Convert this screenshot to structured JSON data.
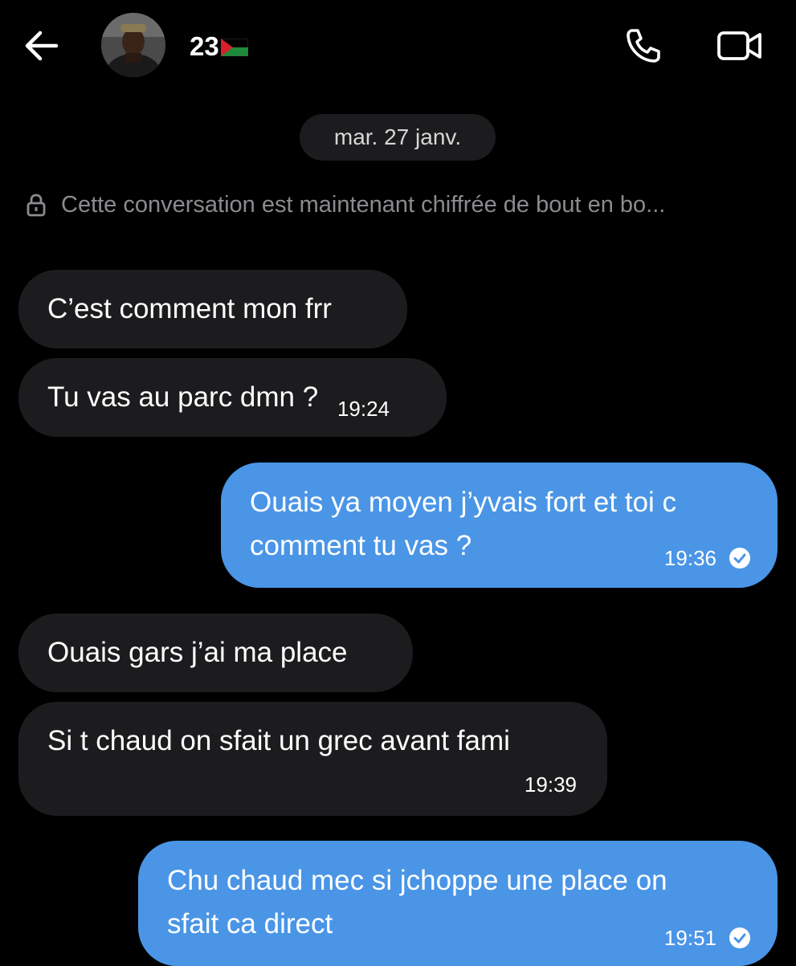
{
  "header": {
    "contact_name": "23",
    "back_icon": "arrow-left-icon",
    "call_icon": "phone-icon",
    "video_icon": "video-camera-icon"
  },
  "date_separator": "mar. 27 janv.",
  "encryption_notice": "Cette conversation est maintenant chiffrée de bout en bo...",
  "messages": [
    {
      "direction": "incoming",
      "text": "C’est comment mon frr",
      "time": ""
    },
    {
      "direction": "incoming",
      "text": "Tu vas au parc dmn ?",
      "time": "19:24"
    },
    {
      "direction": "outgoing",
      "text_line1": "Ouais ya moyen j’yvais fort et toi c",
      "text_line2": "comment tu vas ?",
      "time": "19:36",
      "status": "read"
    },
    {
      "direction": "incoming",
      "text": "Ouais gars j’ai ma place",
      "time": ""
    },
    {
      "direction": "incoming",
      "text": "Si t chaud on sfait un grec avant fami",
      "time": "19:39"
    },
    {
      "direction": "outgoing",
      "text_line1": "Chu chaud mec si jchoppe une place on",
      "text_line2": "sfait ca direct",
      "time": "19:51",
      "status": "read"
    }
  ],
  "colors": {
    "background": "#000000",
    "incoming_bubble": "#1c1c1e",
    "outgoing_bubble": "#4a95e6",
    "muted_text": "#8b8b90"
  }
}
